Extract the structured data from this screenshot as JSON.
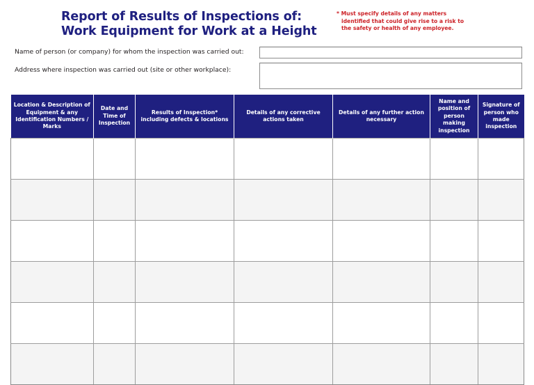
{
  "document": {
    "title_lines": [
      "Report of Results of Inspections of:",
      "Work Equipment for Work at a Height"
    ],
    "note": "* Must specify details of any matters identified that could give rise to a risk to the safety or health of any employee.",
    "title_color": "#1f2080",
    "note_color": "#cc2127"
  },
  "form": {
    "fields": [
      {
        "label": "Name of person (or company) for whom the inspection was carried out:",
        "value": "",
        "placeholder": ""
      },
      {
        "label": "Address where inspection was carried out (site or other workplace):",
        "value": "",
        "placeholder": ""
      }
    ]
  },
  "table": {
    "header_bg": "#1f2080",
    "header_text_color": "#ffffff",
    "row_alt_bg": "#f4f4f4",
    "columns": [
      "Location & Description of Equipment & any Identification Numbers / Marks",
      "Date and Time of Inspection",
      "Results of Inspection* including defects & locations",
      "Details of any corrective actions taken",
      "Details of any further action necessary",
      "Name and position of person making inspection",
      "Signature of person who made inspection"
    ],
    "rows": [
      [
        "",
        "",
        "",
        "",
        "",
        "",
        ""
      ],
      [
        "",
        "",
        "",
        "",
        "",
        "",
        ""
      ],
      [
        "",
        "",
        "",
        "",
        "",
        "",
        ""
      ],
      [
        "",
        "",
        "",
        "",
        "",
        "",
        ""
      ],
      [
        "",
        "",
        "",
        "",
        "",
        "",
        ""
      ],
      [
        "",
        "",
        "",
        "",
        "",
        "",
        ""
      ]
    ]
  }
}
